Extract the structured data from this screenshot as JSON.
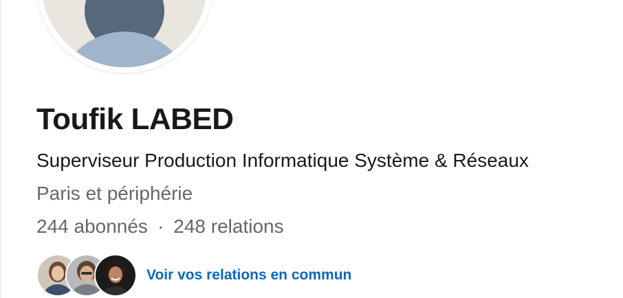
{
  "profile": {
    "name": "Toufik LABED",
    "headline": "Superviseur Production Informatique Système & Réseaux",
    "location": "Paris et périphérie",
    "followers": "244 abonnés",
    "separator": "·",
    "connections": "248 relations"
  },
  "mutual": {
    "link_label": "Voir vos relations en commun",
    "avatars": [
      "mutual-connection-1",
      "mutual-connection-2",
      "mutual-connection-3"
    ]
  },
  "colors": {
    "link": "#0a66c2",
    "name": "#191919",
    "secondary": "#666666"
  }
}
